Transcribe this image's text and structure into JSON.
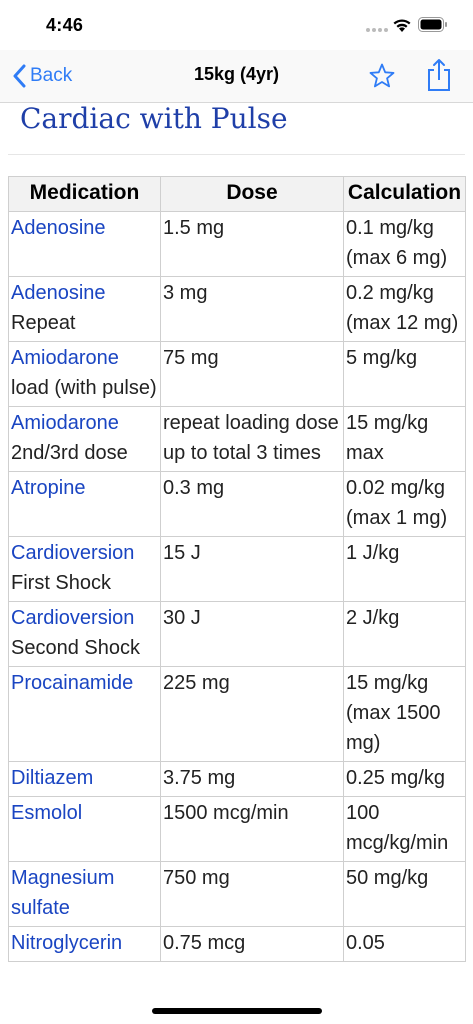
{
  "status_bar": {
    "time": "4:46"
  },
  "nav": {
    "back_label": "Back",
    "title": "15kg (4yr)",
    "accent_color": "#2f7cf6"
  },
  "section": {
    "title": "Cardiac with Pulse"
  },
  "table": {
    "headers": {
      "medication": "Medication",
      "dose": "Dose",
      "calculation": "Calculation"
    },
    "rows": [
      {
        "medication": "Adenosine",
        "detail": "",
        "dose": "1.5 mg",
        "calculation": "0.1 mg/kg (max 6 mg)"
      },
      {
        "medication": "Adenosine",
        "detail": "Repeat",
        "dose": "3 mg",
        "calculation": "0.2 mg/kg (max 12 mg)"
      },
      {
        "medication": "Amiodarone",
        "detail": "load (with pulse)",
        "dose": "75 mg",
        "calculation": "5 mg/kg"
      },
      {
        "medication": "Amiodarone",
        "detail": "2nd/3rd dose",
        "dose": "repeat loading dose up to total 3 times",
        "calculation": "15 mg/kg max"
      },
      {
        "medication": "Atropine",
        "detail": "",
        "dose": "0.3 mg",
        "calculation": "0.02 mg/kg (max 1 mg)"
      },
      {
        "medication": "Cardioversion",
        "detail": "First Shock",
        "dose": "15 J",
        "calculation": "1 J/kg"
      },
      {
        "medication": "Cardioversion",
        "detail": "Second Shock",
        "dose": "30 J",
        "calculation": "2 J/kg"
      },
      {
        "medication": "Procainamide",
        "detail": "",
        "dose": "225 mg",
        "calculation": "15 mg/kg (max 1500 mg)"
      },
      {
        "medication": "Diltiazem",
        "detail": "",
        "dose": "3.75 mg",
        "calculation": "0.25 mg/kg"
      },
      {
        "medication": "Esmolol",
        "detail": "",
        "dose": "1500 mcg/min",
        "calculation": "100 mcg/kg/min"
      },
      {
        "medication": "Magnesium sulfate",
        "detail": "",
        "dose": "750 mg",
        "calculation": "50 mg/kg"
      },
      {
        "medication": "Nitroglycerin",
        "detail": "",
        "dose": "0.75 mcg",
        "calculation": "0.05"
      }
    ]
  },
  "icons": {
    "back": "chevron-left-icon",
    "favorite": "star-icon",
    "share": "share-icon",
    "wifi": "wifi-icon",
    "battery": "battery-icon"
  }
}
